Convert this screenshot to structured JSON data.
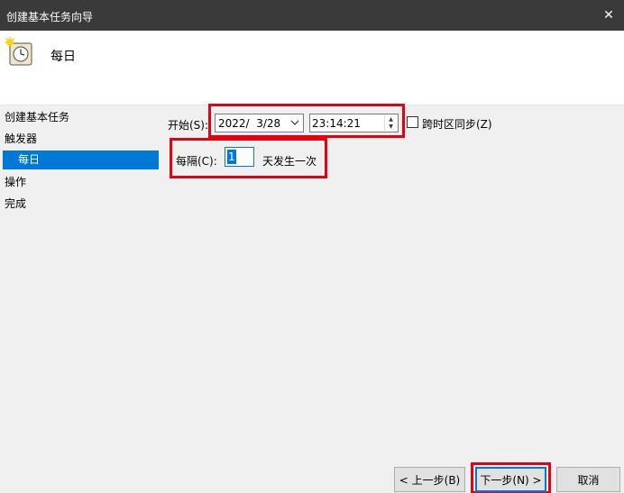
{
  "window": {
    "title": "创建基本任务向导",
    "close_glyph": "✕"
  },
  "header": {
    "heading": "每日"
  },
  "nav": {
    "items": [
      {
        "label": "创建基本任务"
      },
      {
        "label": "触发器"
      },
      {
        "label": "每日",
        "selected": true
      },
      {
        "label": "操作"
      },
      {
        "label": "完成"
      }
    ]
  },
  "form": {
    "start_label": "开始(S):",
    "date_value": "2022/  3/28",
    "time_value": "23:14:21",
    "sync_label": "跨时区同步(Z)",
    "sync_checked": false,
    "interval_label": "每隔(C):",
    "interval_value": "1",
    "interval_suffix": "天发生一次"
  },
  "buttons": {
    "back": "< 上一步(B)",
    "next": "下一步(N) >",
    "cancel": "取消"
  },
  "colors": {
    "accent": "#0078d7",
    "highlight": "#e60012",
    "titlebar": "#3a3a3a"
  }
}
